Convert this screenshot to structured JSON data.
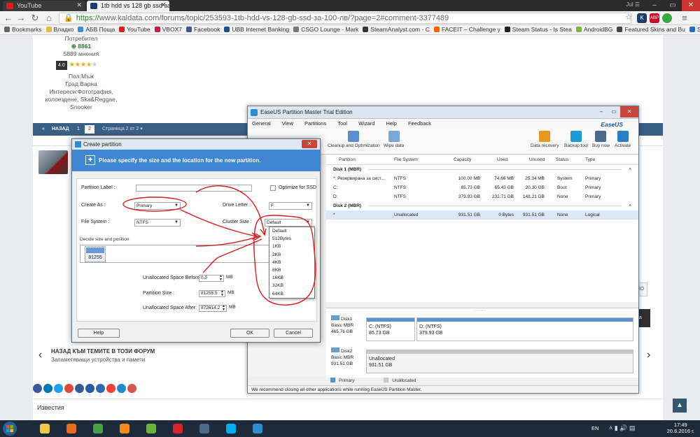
{
  "browser": {
    "tabs": [
      {
        "label": "YouTube",
        "active": false
      },
      {
        "label": "1tb hdd vs 128 gb ssd за",
        "active": true
      }
    ],
    "user": "Jul ☰",
    "url_scheme": "https://",
    "url_rest": "www.kaldata.com/forums/topic/253593-1tb-hdd-vs-128-gb-ssd-за-100-лв/?page=2#comment-3377489",
    "extensions": [
      {
        "label": "K",
        "color": "#1d3d6b"
      },
      {
        "label": "ABP",
        "color": "#c8102e"
      },
      {
        "label": "",
        "color": "#3aa845"
      }
    ],
    "bookmarks": [
      {
        "label": "Bookmarks",
        "color": "#666"
      },
      {
        "label": "Владко",
        "color": "#e8b84a"
      },
      {
        "label": "АБВ Поща",
        "color": "#3b8fd1"
      },
      {
        "label": "YouTube",
        "color": "#d62020"
      },
      {
        "label": "VBOX7",
        "color": "#c41e3a"
      },
      {
        "label": "Facebook",
        "color": "#3b5998"
      },
      {
        "label": "UBB Internet Banking",
        "color": "#1b4f92"
      },
      {
        "label": "CSGO Lounge - Mark",
        "color": "#777"
      },
      {
        "label": "SteamAnalyst.com - C",
        "color": "#333"
      },
      {
        "label": "FACEIT – Challenge y",
        "color": "#f60"
      },
      {
        "label": "Steam Status - Is Stea",
        "color": "#222"
      },
      {
        "label": "AndroidBG",
        "color": "#7bb642"
      },
      {
        "label": "Featured Skins and Bu",
        "color": "#444"
      },
      {
        "label": "Send Money, Pay On",
        "color": "#1f70c1"
      }
    ]
  },
  "forum": {
    "profile": {
      "role": "Потребител",
      "reputation": "8861",
      "posts": "5889 мнения",
      "rating": "4.0",
      "gender": "Пол:Мъж",
      "city": "Град:Варна",
      "interests": "Интереси:Фотография, колоездене, Ska&Reggae, Snooker"
    },
    "pager": {
      "back": "«",
      "prev": "НАЗАД",
      "page1": "1",
      "page2": "2",
      "info": "Страница 2 от 2 ▾"
    },
    "back_topics": "НАЗАД КЪМ ТЕМИТЕ В ТОЗИ ФОРУМ",
    "back_forum": "Запаметяващи устройства и памети",
    "news": "Известия",
    "social_colors": [
      "#3b5998",
      "#0077b5",
      "#1da1f2",
      "#dd4b39",
      "#3b5998",
      "#2a5aa0",
      "#2a6ab5",
      "#ef4136",
      "#1b8bd0",
      "#d9534f"
    ],
    "side_btn": "ПО",
    "side_dark": "на",
    "side_arrow": "›"
  },
  "easeus": {
    "title": "EaseUS Partition Master Trial Edition",
    "menu": [
      "General",
      "View",
      "Partitions",
      "Tool",
      "Wizard",
      "Help",
      "Feedback"
    ],
    "brand": "EaseUS",
    "toolbar_left": [
      "Cleanup and Optimization",
      "Wipe data"
    ],
    "toolbar_right": [
      "Data recovery",
      "Backup tool",
      "Buy now",
      "Activate"
    ],
    "columns": [
      "Partition",
      "File System",
      "Capacity",
      "Used",
      "Unused",
      "Status",
      "Type"
    ],
    "disk1_label": "Disk 1 (MBR)",
    "disk2_label": "Disk 2 (MBR)",
    "disk1_rows": [
      {
        "partition": "*: Резервирана за сист...",
        "fs": "NTFS",
        "capacity": "100.00 MB",
        "used": "74.66 MB",
        "unused": "25.34 MB",
        "status": "System",
        "type": "Primary"
      },
      {
        "partition": "C:",
        "fs": "NTFS",
        "capacity": "85.73 GB",
        "used": "65.43 GB",
        "unused": "20.30 GB",
        "status": "Boot",
        "type": "Primary"
      },
      {
        "partition": "D:",
        "fs": "NTFS",
        "capacity": "379.93 GB",
        "used": "231.71 GB",
        "unused": "148.21 GB",
        "status": "None",
        "type": "Primary"
      }
    ],
    "disk2_rows": [
      {
        "partition": "*",
        "fs": "Unallocated",
        "capacity": "931.51 GB",
        "used": "0 Bytes",
        "unused": "931.51 GB",
        "status": "None",
        "type": "Logical"
      }
    ],
    "map": {
      "disk1": {
        "name": "Disk1",
        "kind": "Basic MBR",
        "size": "465.76 GB",
        "p1": "C: (NTFS)",
        "p1size": "85.73 GB",
        "p2": "D: (NTFS)",
        "p2size": "379.93 GB"
      },
      "disk2": {
        "name": "Disk2",
        "kind": "Basic MBR",
        "size": "931.51 GB",
        "p1": "Unallocated",
        "p1size": "931.51 GB"
      }
    },
    "legend": [
      "Primary",
      "Unallocated"
    ],
    "status": "We recommend closing all other applications while running EaseUS Partition Master."
  },
  "dialog": {
    "title": "Create partition",
    "close": "✕",
    "heading": "Please specify the size and the location for the new partition.",
    "partition_label": "Partition Label :",
    "optimize": "Optimize for SSD",
    "create_as": "Create As :",
    "create_as_value": "Primary",
    "drive_letter": "Drive Letter :",
    "drive_letter_value": "F:",
    "file_system": "File System :",
    "file_system_value": "NTFS",
    "cluster_size": "Cluster Size :",
    "cluster_value": "Default",
    "decide": "Decide size and position",
    "block_value": "81255",
    "unalloc_before": "Unallocated Space Before:",
    "unalloc_before_value": "0.0",
    "partition_size": "Partition Size :",
    "partition_size_value": "81255.5",
    "unalloc_after": "Unallocated Space After:",
    "unalloc_after_value": "872614.2",
    "unit": "MB",
    "help": "Help",
    "ok": "OK",
    "cancel": "Cancel",
    "cluster_options": [
      "Default",
      "512Bytes",
      "1KB",
      "2KB",
      "4KB",
      "8KB",
      "16KB",
      "32KB",
      "64KB"
    ]
  },
  "taskbar": {
    "lang": "EN",
    "time": "17:49",
    "date": "20.6.2016 г.",
    "apps": [
      {
        "name": "explorer",
        "color": "#f2c84b"
      },
      {
        "name": "media",
        "color": "#e66b1f"
      },
      {
        "name": "chrome",
        "color": "#4aa04a"
      },
      {
        "name": "vlc",
        "color": "#f08a1c"
      },
      {
        "name": "utorrent",
        "color": "#6bb23a"
      },
      {
        "name": "opera",
        "color": "#d8232a"
      },
      {
        "name": "steam",
        "color": "#4b6b8a"
      },
      {
        "name": "skype",
        "color": "#00aff0"
      },
      {
        "name": "easeus",
        "color": "#2a8fd0"
      }
    ]
  }
}
